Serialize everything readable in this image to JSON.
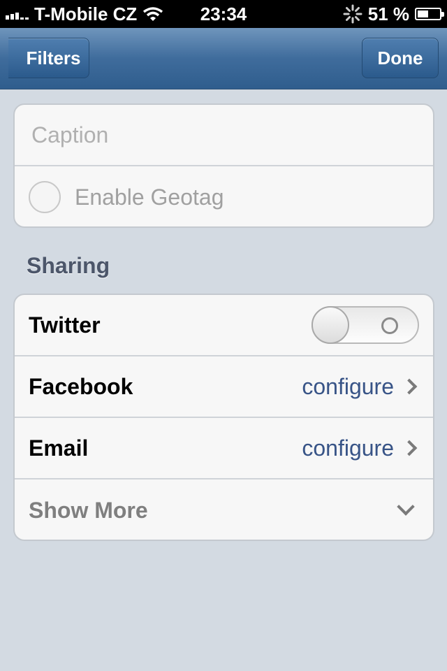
{
  "status_bar": {
    "carrier": "T-Mobile CZ",
    "time": "23:34",
    "battery_percent": "51 %",
    "battery_level": 0.51
  },
  "navbar": {
    "back_label": "Filters",
    "done_label": "Done"
  },
  "details": {
    "caption_placeholder": "Caption",
    "geotag_label": "Enable Geotag"
  },
  "sharing": {
    "header": "Sharing",
    "twitter": {
      "label": "Twitter",
      "toggle_on": false
    },
    "facebook": {
      "label": "Facebook",
      "action": "configure"
    },
    "email": {
      "label": "Email",
      "action": "configure"
    },
    "show_more": {
      "label": "Show More"
    }
  },
  "colors": {
    "nav_blue": "#3f6c9c",
    "link_blue": "#385487",
    "background": "#d3dae2"
  },
  "icons": [
    "signal-icon",
    "wifi-icon",
    "activity-spinner-icon",
    "battery-icon",
    "chevron-right-icon",
    "chevron-down-icon"
  ]
}
